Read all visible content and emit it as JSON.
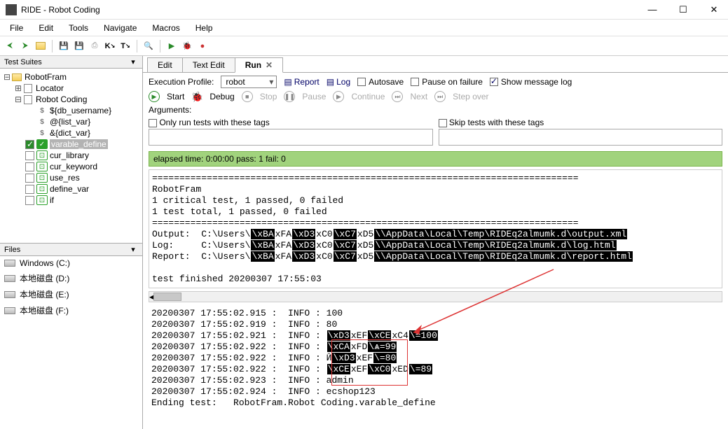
{
  "window": {
    "title": "RIDE - Robot Coding"
  },
  "menu": {
    "file": "File",
    "edit": "Edit",
    "tools": "Tools",
    "navigate": "Navigate",
    "macros": "Macros",
    "help": "Help"
  },
  "panels": {
    "test_suites": "Test Suites",
    "files": "Files"
  },
  "tree": {
    "root": "RobotFram",
    "items": [
      {
        "label": "Locator",
        "kind": "page"
      },
      {
        "label": "Robot Coding",
        "kind": "page",
        "children": [
          {
            "label": "${db_username}",
            "kind": "var"
          },
          {
            "label": "@{list_var}",
            "kind": "var"
          },
          {
            "label": "&{dict_var}",
            "kind": "var"
          },
          {
            "label": "varable_define",
            "kind": "test",
            "check": true,
            "selected": true
          },
          {
            "label": "cur_library",
            "kind": "test"
          },
          {
            "label": "cur_keyword",
            "kind": "test"
          },
          {
            "label": "use_res",
            "kind": "test"
          },
          {
            "label": "define_var",
            "kind": "test"
          },
          {
            "label": "if",
            "kind": "test"
          }
        ]
      }
    ]
  },
  "disks": [
    {
      "label": "Windows (C:)"
    },
    {
      "label": "本地磁盘 (D:)"
    },
    {
      "label": "本地磁盘 (E:)"
    },
    {
      "label": "本地磁盘 (F:)"
    }
  ],
  "tabs": {
    "edit": "Edit",
    "text_edit": "Text Edit",
    "run": "Run"
  },
  "run": {
    "exec_profile_label": "Execution Profile:",
    "exec_profile_value": "robot",
    "report": "Report",
    "log": "Log",
    "autosave": "Autosave",
    "pause_on_failure": "Pause on failure",
    "show_msg_log": "Show message log",
    "start": "Start",
    "debug": "Debug",
    "stop": "Stop",
    "pause": "Pause",
    "continue": "Continue",
    "next": "Next",
    "step_over": "Step over",
    "arguments_label": "Arguments:",
    "only_tags": "Only run tests with these tags",
    "skip_tags": "Skip tests with these tags"
  },
  "status": {
    "text": "elapsed time: 0:00:00     pass: 1     fail: 0"
  },
  "output_top": "==============================================================================\nRobotFram\n1 critical test, 1 passed, 0 failed\n1 test total, 1 passed, 0 failed\n==============================================================================\nOutput:  C:\\Users\\§xBA§xFA§xD3§xC0§xC7§xD5§\\AppData\\Local\\Temp\\RIDEq2almumk.d\\output.xml\nLog:     C:\\Users\\§xBA§xFA§xD3§xC0§xC7§xD5§\\AppData\\Local\\Temp\\RIDEq2almumk.d\\log.html\nReport:  C:\\Users\\§xBA§xFA§xD3§xC0§xC7§xD5§\\AppData\\Local\\Temp\\RIDEq2almumk.d\\report.html\n\ntest finished 20200307 17:55:03",
  "output_bottom": "20200307 17:55:02.915 :  INFO : 100\n20200307 17:55:02.919 :  INFO : 80\n20200307 17:55:02.921 :  INFO : §xD3§xEF§xCE§xC4§=100\n20200307 17:55:02.922 :  INFO : §xCA§xFD§ѧ=99\n20200307 17:55:02.922 :  INFO : Ӣ§xD3§xEF§=80\n20200307 17:55:02.922 :  INFO : §xCE§xEF§xC0§xED§=89\n20200307 17:55:02.923 :  INFO : admin\n20200307 17:55:02.924 :  INFO : ecshop123\nEnding test:   RobotFram.Robot Coding.varable_define"
}
